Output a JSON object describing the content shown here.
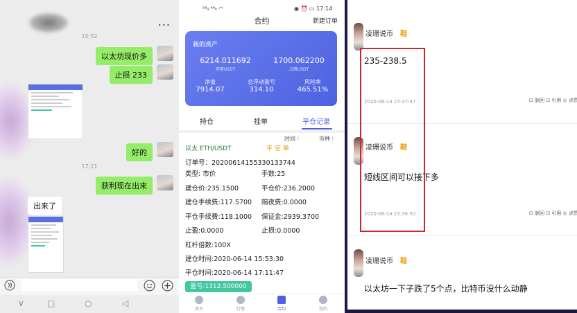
{
  "chat": {
    "more": "...",
    "time1": "15:52",
    "time2": "17:11",
    "msg1": "以太坊现价多",
    "msg2": "止损 233",
    "msg3": "好的",
    "msg4": "获利现在出来",
    "msg5": "出来了",
    "icons": {
      "voice": "voice-icon",
      "emoji": "emoji-icon",
      "add": "add-icon"
    },
    "nav": {
      "back": "∨",
      "home": "□",
      "circle": "○",
      "tri": "◁"
    }
  },
  "phone": {
    "status_left": "⁵⁶ₗₗ ⁴⁶ₗₗ ◠",
    "status_right": "◉ ⏰ ▭ 17:14",
    "title": "合约",
    "new_order": "新建订单",
    "assets": {
      "title": "我的资产",
      "available_value": "6214.011692",
      "available_label": "可用USDT",
      "used_value": "1700.062200",
      "used_label": "占用USDT",
      "net_label": "净值",
      "net_value": "7914.07",
      "float_label": "总浮动盈亏",
      "float_value": "314.10",
      "risk_label": "风险率",
      "risk_value": "465.51%"
    },
    "tabs": [
      "持仓",
      "挂单",
      "平仓记录"
    ],
    "filter_time": "时间 ⁝",
    "filter_coin": "币种 ⁝",
    "cut_left": "以太 ETH/USDT",
    "cut_right": "平 空 单",
    "order": {
      "order_no": "订单号：20200614155330133744",
      "type": "类型: 市价",
      "qty": "手数:25",
      "open_price": "建仓价:235.1500",
      "close_price": "平仓价:236.2000",
      "open_fee": "建仓手续费:117.5700",
      "overnight_fee": "隔夜费:0.0000",
      "close_fee": "平仓手续费:118.1000",
      "deposit": "保证金:2939.3700",
      "tp": "止盈:0.0000",
      "sl": "止损:0.0000",
      "leverage": "杠杆倍数:100X",
      "open_time": "建仓时间:2020-06-14 15:53:30",
      "close_time": "平仓时间:2020-06-14 17:11:47",
      "profit": "盈亏:1312.500000"
    },
    "nav": [
      "首页",
      "行情",
      "合约",
      "我的"
    ]
  },
  "posts": [
    {
      "name": "凌珊说币",
      "badge": "鞋",
      "body": "235-238.5",
      "time": "2020-06-14 15:37:47",
      "actions": "⊡ 删回  ⊡ 引用  ◎ 点赞"
    },
    {
      "name": "凌珊说币",
      "badge": "鞋",
      "body": "短线区间可以接下多",
      "time": "2020-06-14 15:36:50",
      "actions": "⊡ 删回  ⊡ 引用  ◎ 点赞"
    },
    {
      "name": "凌珊说币",
      "badge": "鞋",
      "body": "以太坊一下子跌了5个点，比特币没什么动静",
      "time": "",
      "actions": ""
    }
  ]
}
